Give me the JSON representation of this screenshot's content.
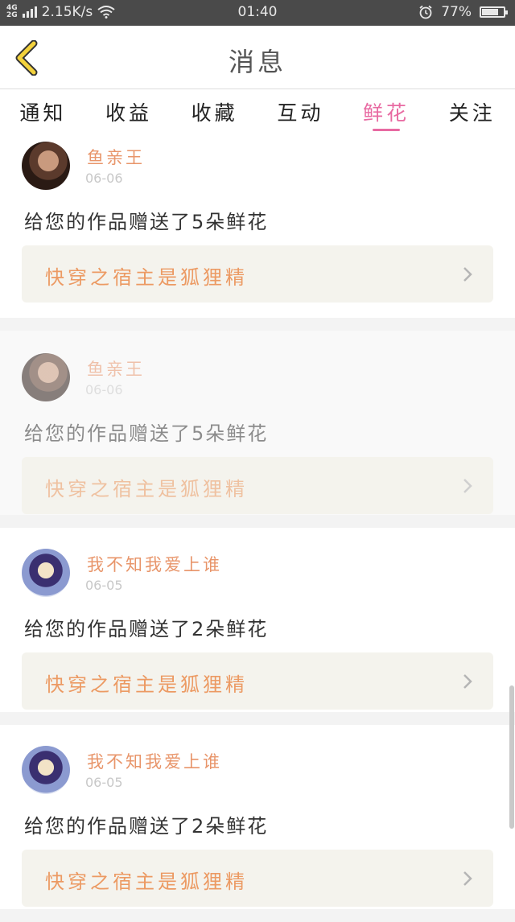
{
  "status_bar": {
    "network_top": "4G",
    "network_bottom": "2G",
    "speed": "2.15K/s",
    "time": "01:40",
    "battery": "77%",
    "battery_level": 0.77
  },
  "header": {
    "title": "消息"
  },
  "tabs": [
    {
      "label": "通知",
      "active": false
    },
    {
      "label": "收益",
      "active": false
    },
    {
      "label": "收藏",
      "active": false
    },
    {
      "label": "互动",
      "active": false
    },
    {
      "label": "鲜花",
      "active": true
    },
    {
      "label": "关注",
      "active": false
    }
  ],
  "messages": [
    {
      "name": "鱼亲王",
      "date": "06-06",
      "text": "给您的作品赠送了5朵鲜花",
      "work": "快穿之宿主是狐狸精",
      "faded": false
    },
    {
      "name": "鱼亲王",
      "date": "06-06",
      "text": "给您的作品赠送了5朵鲜花",
      "work": "快穿之宿主是狐狸精",
      "faded": true
    },
    {
      "name": "我不知我爱上谁",
      "date": "06-05",
      "text": "给您的作品赠送了2朵鲜花",
      "work": "快穿之宿主是狐狸精",
      "faded": false
    },
    {
      "name": "我不知我爱上谁",
      "date": "06-05",
      "text": "给您的作品赠送了2朵鲜花",
      "work": "快穿之宿主是狐狸精",
      "faded": false
    }
  ],
  "colors": {
    "accent": "#e86aa2",
    "name": "#e8956a",
    "work_title": "#ec9a63",
    "back_arrow": "#f3d23c"
  }
}
